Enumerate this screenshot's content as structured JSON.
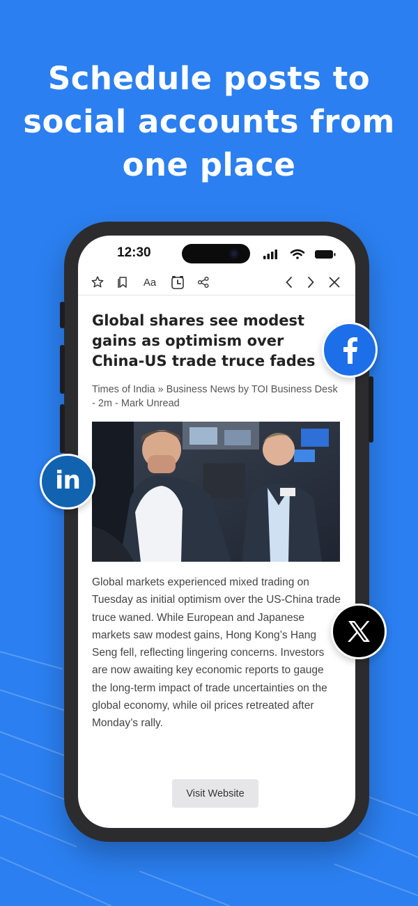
{
  "headline": {
    "line1": "Schedule posts to",
    "line2": "social accounts from",
    "line3": "one place"
  },
  "status_bar": {
    "time": "12:30"
  },
  "toolbar": {
    "font_label": "Aa",
    "icons": [
      "star-icon",
      "bookmark-icon",
      "font-size-icon",
      "alarm-clock-icon",
      "share-icon",
      "chevron-left-icon",
      "chevron-right-icon",
      "close-icon"
    ]
  },
  "article": {
    "title": "Global shares see modest gains as optimism over China-US trade truce fades",
    "meta": "Times of India » Business News by TOI Business Desk - 2m - Mark Unread",
    "body": "Global markets experienced mixed trading on Tuesday as initial optimism over the US-China trade truce waned. While European and Japanese markets saw modest gains, Hong Kong’s Hang Seng fell, reflecting lingering concerns. Investors are now awaiting key economic reports to gauge the long-term impact of trade uncertainties on the global economy, while oil prices retreated after Monday’s rally.",
    "visit_button": "Visit Website"
  },
  "social": {
    "linkedin_label": "in",
    "icons": [
      "facebook-icon",
      "linkedin-icon",
      "x-icon"
    ]
  },
  "colors": {
    "background": "#2b7ff0",
    "facebook": "#1c6fe8",
    "linkedin": "#1163b0",
    "x": "#000000"
  }
}
